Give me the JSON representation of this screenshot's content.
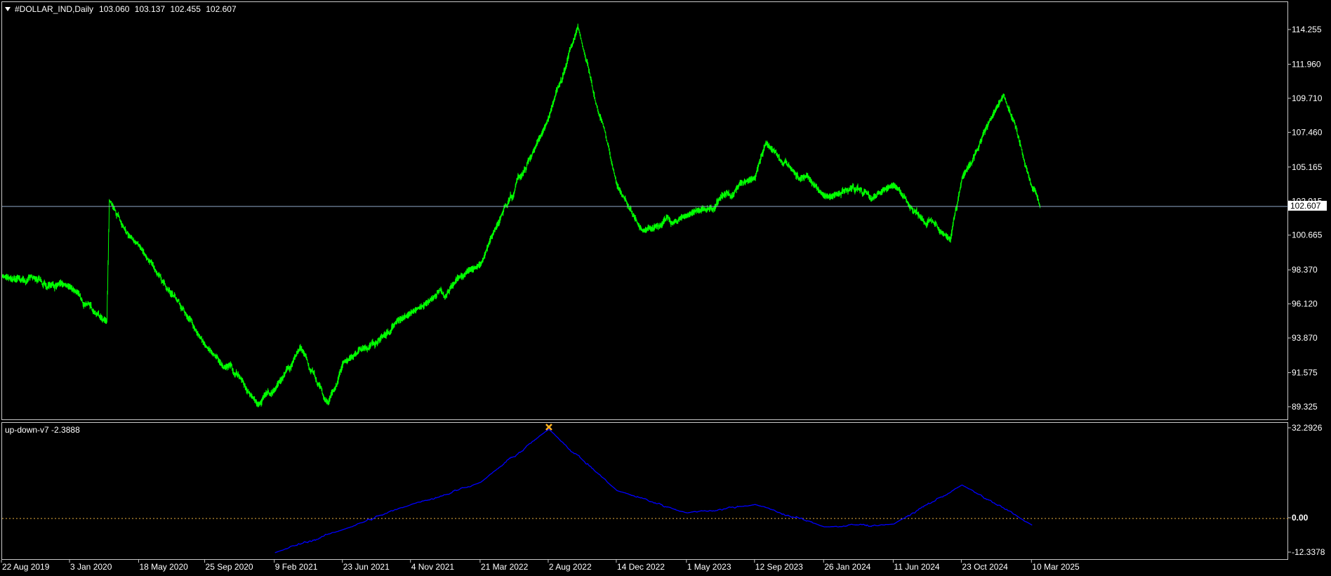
{
  "main": {
    "symbol": "#DOLLAR_IND,Daily",
    "ohlc": [
      "103.060",
      "103.137",
      "102.455",
      "102.607"
    ],
    "current_price": "102.607",
    "price_label": "102.607",
    "price_axis": [
      "114.255",
      "111.960",
      "109.710",
      "107.460",
      "105.165",
      "102.915",
      "100.665",
      "98.370",
      "96.120",
      "93.870",
      "91.575",
      "89.325"
    ],
    "line_color": "#00ff00",
    "price_line_color": "#8fa8c8"
  },
  "indicator": {
    "name": "up-down-v7",
    "value": "-2.3888",
    "axis": [
      "32.2926",
      "0.00",
      "-12.3378"
    ],
    "line_color": "#0000ff",
    "zero_line_color": "#e8b040",
    "marker_color": "#ffb020"
  },
  "time_axis": [
    "22 Aug 2019",
    "3 Jan 2020",
    "18 May 2020",
    "25 Sep 2020",
    "9 Feb 2021",
    "23 Jun 2021",
    "4 Nov 2021",
    "21 Mar 2022",
    "2 Aug 2022",
    "14 Dec 2022",
    "1 May 2023",
    "12 Sep 2023",
    "26 Jan 2024",
    "11 Jun 2024",
    "23 Oct 2024",
    "10 Mar 2025"
  ],
  "chart_data": {
    "type": "line",
    "series": [
      {
        "x": [
          "22 Aug 2019",
          "3 Jan 2020",
          "15 Mar 2020",
          "20 Mar 2020",
          "18 May 2020",
          "25 Sep 2020",
          "6 Jan 2021",
          "9 Feb 2021",
          "31 Mar 2021",
          "25 May 2021",
          "23 Jun 2021",
          "4 Nov 2021",
          "21 Mar 2022",
          "2 Aug 2022",
          "28 Sep 2022",
          "14 Dec 2022",
          "2 Feb 2023",
          "1 May 2023",
          "12 Sep 2023",
          "3 Oct 2023",
          "26 Jan 2024",
          "11 Jun 2024",
          "30 Sep 2024",
          "23 Oct 2024",
          "13 Jan 2025",
          "10 Mar 2025",
          "25 Mar 2025"
        ],
        "y": [
          98.0,
          97.3,
          95.0,
          103.0,
          100.0,
          93.4,
          89.5,
          90.5,
          93.3,
          89.6,
          92.3,
          95.6,
          98.8,
          108.5,
          114.5,
          104.0,
          101.0,
          102.0,
          104.5,
          106.8,
          103.3,
          104.0,
          100.4,
          104.5,
          110.0,
          103.8,
          102.607
        ]
      }
    ],
    "ylim": [
      88.5,
      115.5
    ]
  },
  "indicator_chart": {
    "type": "line",
    "series": [
      {
        "name": "up-down-v7",
        "x": [
          "9 Feb 2021",
          "23 Jun 2021",
          "4 Nov 2021",
          "21 Mar 2022",
          "2 Aug 2022",
          "14 Dec 2022",
          "1 May 2023",
          "12 Sep 2023",
          "26 Jan 2024",
          "11 Jun 2024",
          "23 Oct 2024",
          "10 Mar 2025"
        ],
        "y": [
          -12.3,
          -4.0,
          5.0,
          13.0,
          32.0,
          10.0,
          2.0,
          5.0,
          -3.0,
          -2.0,
          12.0,
          -2.3888
        ]
      }
    ],
    "ylim": [
      -12.3378,
      32.2926
    ]
  }
}
